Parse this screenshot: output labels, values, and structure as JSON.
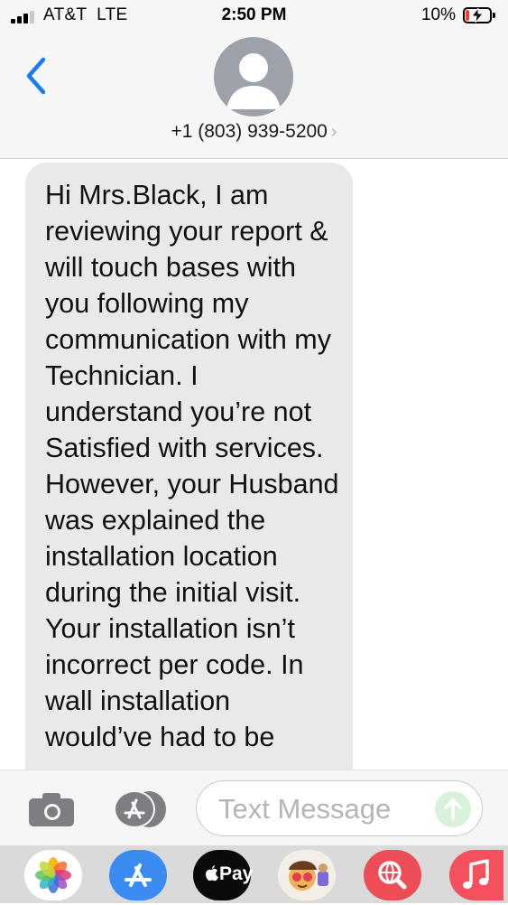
{
  "status_bar": {
    "carrier": "AT&T  LTE",
    "time": "2:50 PM",
    "battery_pct": "10%",
    "signal_bars": 3,
    "battery_level": 0.1,
    "battery_color": "#ff3b30"
  },
  "header": {
    "back_icon": "chevron-left-icon",
    "contact": "+1 (803) 939-5200",
    "contact_chevron": "›",
    "accent_color": "#1a7cf5"
  },
  "message": {
    "text": "Hi Mrs.Black, I am reviewing your report & will touch bases with you following my communication with my Technician. I understand you’re not Satisfied with services. However, your Husband was explained the installation location during the initial visit. Your installation isn’t incorrect per code. In wall installation would’ve had to be"
  },
  "input_bar": {
    "placeholder": "Text Message",
    "camera_icon": "camera-icon",
    "appstore_icon": "app-store-icon",
    "send_icon": "send-arrow-icon",
    "send_color": "#d9f2dc"
  },
  "app_drawer": {
    "apps": [
      {
        "name": "photos-app-icon"
      },
      {
        "name": "app-store-app-icon"
      },
      {
        "name": "apple-pay-app-icon",
        "label": "Pay"
      },
      {
        "name": "memoji-stickers-app-icon"
      },
      {
        "name": "web-search-app-icon"
      },
      {
        "name": "music-app-icon"
      }
    ]
  }
}
